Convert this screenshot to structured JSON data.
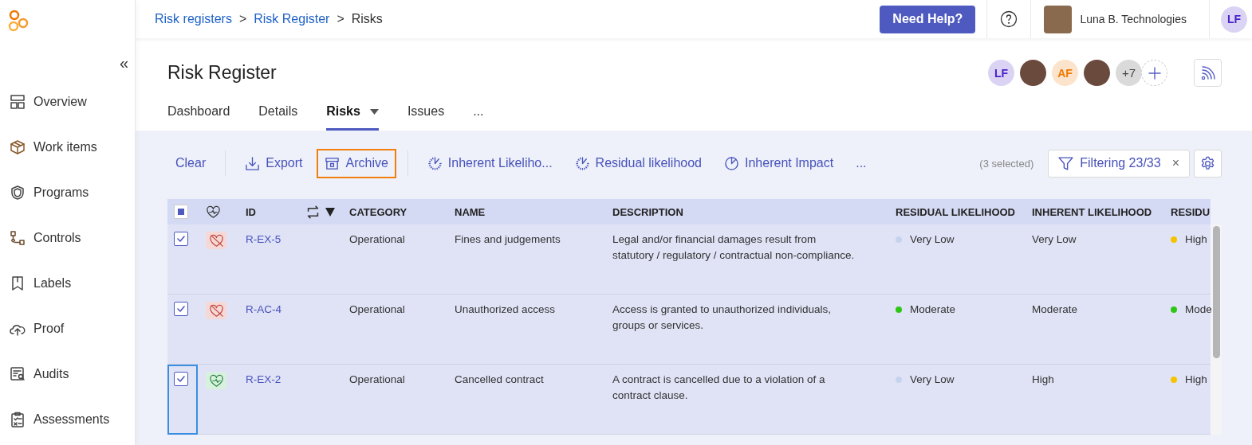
{
  "sidebar": {
    "collapse": "«",
    "items": [
      {
        "label": "Overview"
      },
      {
        "label": "Work items"
      },
      {
        "label": "Programs"
      },
      {
        "label": "Controls"
      },
      {
        "label": "Labels"
      },
      {
        "label": "Proof"
      },
      {
        "label": "Audits"
      },
      {
        "label": "Assessments"
      }
    ]
  },
  "breadcrumb": [
    {
      "label": "Risk registers",
      "link": true
    },
    {
      "label": "Risk Register",
      "link": true
    },
    {
      "label": "Risks",
      "link": false
    }
  ],
  "breadcrumb_separator": ">",
  "help_button": "Need Help?",
  "account": {
    "name": "Luna B. Technologies"
  },
  "user_avatar": {
    "initials": "LF",
    "color": "#4b22c9"
  },
  "page_title": "Risk Register",
  "members": [
    {
      "kind": "initials",
      "initials": "LF",
      "color": "#4b22c9"
    },
    {
      "kind": "photo"
    },
    {
      "kind": "initials",
      "initials": "AF",
      "color": "#f07800"
    },
    {
      "kind": "photo"
    },
    {
      "kind": "count",
      "label": "+7"
    },
    {
      "kind": "add"
    }
  ],
  "tabs": [
    {
      "label": "Dashboard",
      "selected": false,
      "dropdown": false
    },
    {
      "label": "Details",
      "selected": false,
      "dropdown": false
    },
    {
      "label": "Risks",
      "selected": true,
      "dropdown": true
    },
    {
      "label": "Issues",
      "selected": false,
      "dropdown": false
    },
    {
      "label": "...",
      "selected": false,
      "dropdown": false
    }
  ],
  "toolbar": {
    "groups": [
      [
        {
          "label": "Clear",
          "highlighted": false
        }
      ],
      [
        {
          "label": "Export",
          "highlighted": false
        },
        {
          "label": "Archive",
          "highlighted": true
        }
      ],
      [
        {
          "label": "Inherent Likeliho...",
          "highlighted": false
        },
        {
          "label": "Residual likelihood",
          "highlighted": false
        },
        {
          "label": "Inherent Impact",
          "highlighted": false
        },
        {
          "label": "...",
          "highlighted": false
        }
      ]
    ],
    "selection_count": "(3 selected)",
    "filter": {
      "label": "Filtering 23/33",
      "clear": "×"
    }
  },
  "table": {
    "select_all": {
      "indeterminate": true
    },
    "columns": [
      "ID",
      "CATEGORY",
      "NAME",
      "DESCRIPTION",
      "RESIDUAL LIKELIHOOD",
      "INHERENT LIKELIHOOD",
      "RESIDU"
    ],
    "rows": [
      {
        "checked": true,
        "focused": false,
        "healthy": false,
        "id": "R-EX-5",
        "category": "Operational",
        "name": "Fines and judgements",
        "description": "Legal and/or financial damages result from statutory / regulatory / contractual non-compliance.",
        "residual_likelihood": {
          "label": "Very Low",
          "color": "#c6d3ee"
        },
        "inherent_likelihood": "Very Low",
        "column_9": {
          "label": "High",
          "color": "#f5c400"
        }
      },
      {
        "checked": true,
        "focused": false,
        "healthy": false,
        "id": "R-AC-4",
        "category": "Operational",
        "name": "Unauthorized access",
        "description": "Access is granted to unauthorized individuals, groups or services.",
        "residual_likelihood": {
          "label": "Moderate",
          "color": "#2fc715"
        },
        "inherent_likelihood": "Moderate",
        "column_9": {
          "label": "Mode",
          "color": "#2fc715"
        }
      },
      {
        "checked": true,
        "focused": true,
        "healthy": true,
        "id": "R-EX-2",
        "category": "Operational",
        "name": "Cancelled contract",
        "description": "A contract is cancelled due to a violation of a contract clause.",
        "residual_likelihood": {
          "label": "Very Low",
          "color": "#c6d3ee"
        },
        "inherent_likelihood": "High",
        "column_9": {
          "label": "High",
          "color": "#f5c400"
        }
      }
    ]
  }
}
